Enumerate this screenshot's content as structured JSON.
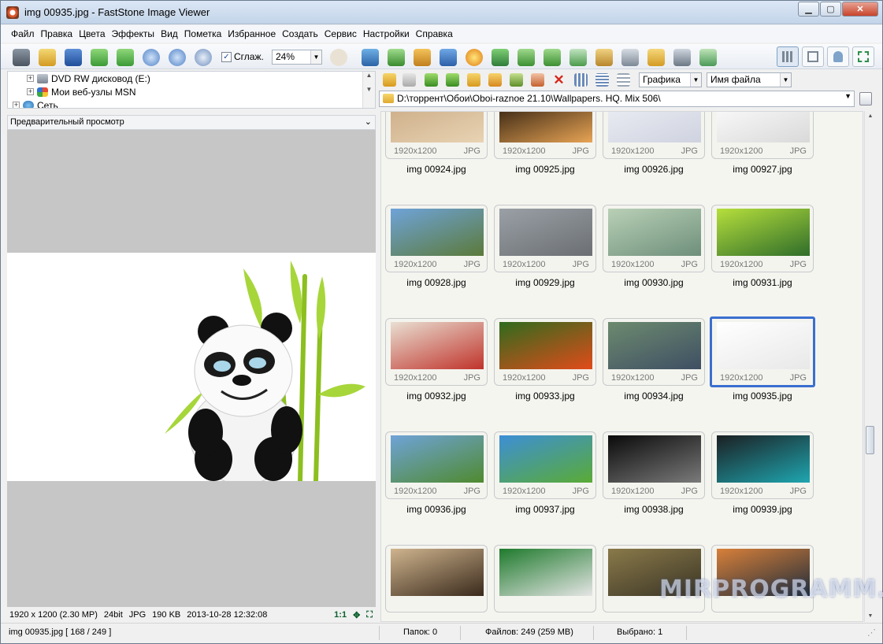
{
  "window": {
    "title": "img 00935.jpg  -  FastStone Image Viewer"
  },
  "menu": [
    "Файл",
    "Правка",
    "Цвета",
    "Эффекты",
    "Вид",
    "Пометка",
    "Избранное",
    "Создать",
    "Сервис",
    "Настройки",
    "Справка"
  ],
  "toolbar": {
    "smooth_label": "Сглаж.",
    "smooth_checked": true,
    "zoom_value": "24%"
  },
  "tree": {
    "items": [
      {
        "label": "DVD RW дисковод (E:)"
      },
      {
        "label": "Мои веб-узлы MSN"
      },
      {
        "label": "Сеть"
      }
    ]
  },
  "preview": {
    "header": "Предварительный просмотр"
  },
  "info": {
    "dims": "1920 x 1200 (2.30 MP)",
    "bits": "24bit",
    "fmt": "JPG",
    "size": "190 KB",
    "date": "2013-10-28 12:32:08",
    "ratio": "1:1"
  },
  "filters": {
    "type": "Графика",
    "sort": "Имя файла"
  },
  "path": "D:\\торрент\\Обои\\Oboi-raznoe 21.10\\Wallpapers. HQ. Mix 506\\",
  "thumbs": [
    {
      "name": "img 00924.jpg",
      "res": "1920x1200",
      "fmt": "JPG",
      "colors": [
        "#c9a882",
        "#e8d3b3"
      ]
    },
    {
      "name": "img 00925.jpg",
      "res": "1920x1200",
      "fmt": "JPG",
      "colors": [
        "#1d1208",
        "#e8a455"
      ]
    },
    {
      "name": "img 00926.jpg",
      "res": "1920x1200",
      "fmt": "JPG",
      "colors": [
        "#eef0f5",
        "#cfd3e0"
      ]
    },
    {
      "name": "img 00927.jpg",
      "res": "1920x1200",
      "fmt": "JPG",
      "colors": [
        "#ffffff",
        "#d9d9d9"
      ]
    },
    {
      "name": "img 00928.jpg",
      "res": "1920x1200",
      "fmt": "JPG",
      "colors": [
        "#6fa3d9",
        "#5b7a3a"
      ]
    },
    {
      "name": "img 00929.jpg",
      "res": "1920x1200",
      "fmt": "JPG",
      "colors": [
        "#9aa0a6",
        "#6b6f73"
      ]
    },
    {
      "name": "img 00930.jpg",
      "res": "1920x1200",
      "fmt": "JPG",
      "colors": [
        "#b9d0b6",
        "#6e8f7b"
      ]
    },
    {
      "name": "img 00931.jpg",
      "res": "1920x1200",
      "fmt": "JPG",
      "colors": [
        "#b6df3c",
        "#2f6d2a"
      ]
    },
    {
      "name": "img 00932.jpg",
      "res": "1920x1200",
      "fmt": "JPG",
      "colors": [
        "#e9dfd2",
        "#c0332b"
      ]
    },
    {
      "name": "img 00933.jpg",
      "res": "1920x1200",
      "fmt": "JPG",
      "colors": [
        "#2f6b1d",
        "#e24b1a"
      ]
    },
    {
      "name": "img 00934.jpg",
      "res": "1920x1200",
      "fmt": "JPG",
      "colors": [
        "#6d8a6f",
        "#3e4f63"
      ]
    },
    {
      "name": "img 00935.jpg",
      "res": "1920x1200",
      "fmt": "JPG",
      "colors": [
        "#ffffff",
        "#e8e8e8"
      ],
      "selected": true
    },
    {
      "name": "img 00936.jpg",
      "res": "1920x1200",
      "fmt": "JPG",
      "colors": [
        "#6fa3d8",
        "#4f8a2f"
      ]
    },
    {
      "name": "img 00937.jpg",
      "res": "1920x1200",
      "fmt": "JPG",
      "colors": [
        "#3d8fd6",
        "#5aab35"
      ]
    },
    {
      "name": "img 00938.jpg",
      "res": "1920x1200",
      "fmt": "JPG",
      "colors": [
        "#0a0a0a",
        "#7a7a7a"
      ]
    },
    {
      "name": "img 00939.jpg",
      "res": "1920x1200",
      "fmt": "JPG",
      "colors": [
        "#1b1f22",
        "#1fa6b0"
      ]
    },
    {
      "name": "",
      "res": "",
      "fmt": "",
      "colors": [
        "#cfb48e",
        "#3a2a1c"
      ]
    },
    {
      "name": "",
      "res": "",
      "fmt": "",
      "colors": [
        "#1f7a2d",
        "#e5e5e5"
      ]
    },
    {
      "name": "",
      "res": "",
      "fmt": "",
      "colors": [
        "#8a7a4a",
        "#3a3425"
      ]
    },
    {
      "name": "",
      "res": "",
      "fmt": "",
      "colors": [
        "#d8803a",
        "#1e2c3a"
      ]
    }
  ],
  "watermark": "MIRPROGRAMM.RU",
  "status": {
    "file": "img 00935.jpg [ 168 / 249 ]",
    "folders": "Папок: 0",
    "files": "Файлов: 249 (259 MB)",
    "selected": "Выбрано: 1"
  }
}
